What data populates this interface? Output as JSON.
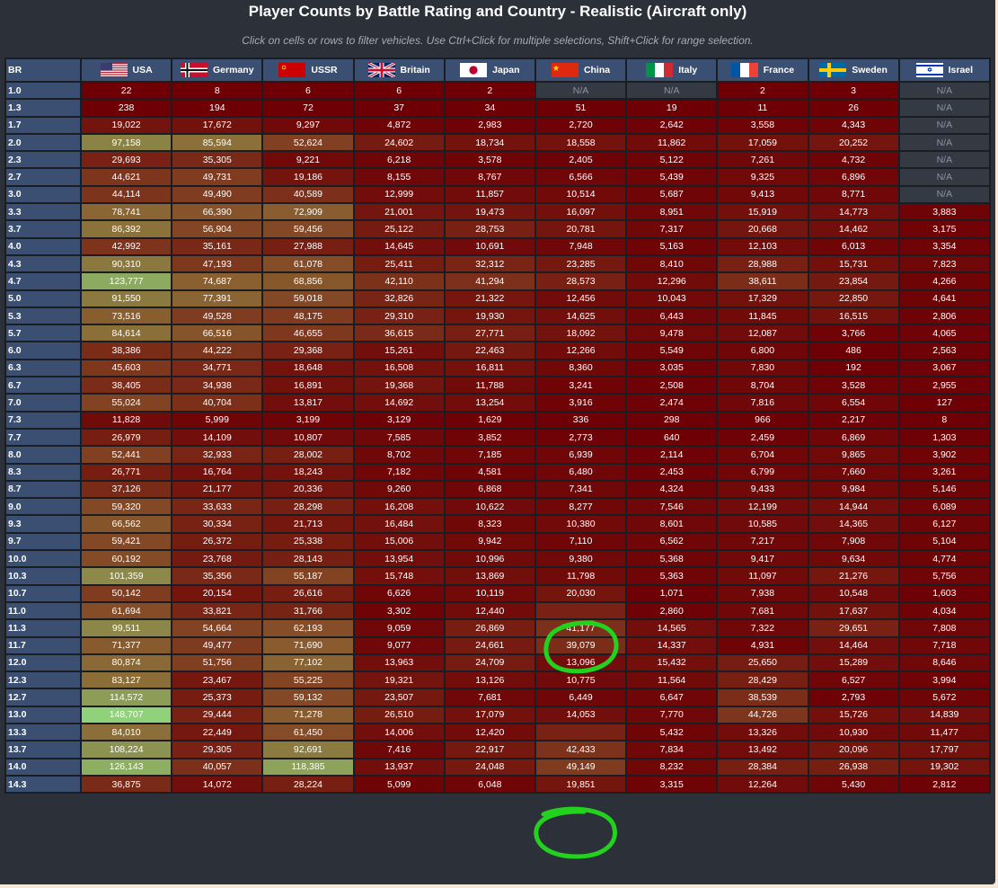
{
  "title": "Player Counts by Battle Rating and Country - Realistic (Aircraft only)",
  "subtitle": "Click on cells or rows to filter vehicles. Use Ctrl+Click for multiple selections, Shift+Click for range selection.",
  "br_header": "BR",
  "na_label": "N/A",
  "color_scale": {
    "low": "#6e0005",
    "mid": "#8a6030",
    "high": "#8fd47a"
  },
  "countries": [
    {
      "name": "USA",
      "flag": "usa-flag-icon"
    },
    {
      "name": "Germany",
      "flag": "germany-flag-icon"
    },
    {
      "name": "USSR",
      "flag": "ussr-flag-icon"
    },
    {
      "name": "Britain",
      "flag": "britain-flag-icon"
    },
    {
      "name": "Japan",
      "flag": "japan-flag-icon"
    },
    {
      "name": "China",
      "flag": "china-flag-icon"
    },
    {
      "name": "Italy",
      "flag": "italy-flag-icon"
    },
    {
      "name": "France",
      "flag": "france-flag-icon"
    },
    {
      "name": "Sweden",
      "flag": "sweden-flag-icon"
    },
    {
      "name": "Israel",
      "flag": "israel-flag-icon"
    }
  ],
  "rows": [
    {
      "br": "1.0",
      "values": [
        "22",
        "8",
        "6",
        "6",
        "2",
        "N/A",
        "N/A",
        "2",
        "3",
        "N/A"
      ]
    },
    {
      "br": "1.3",
      "values": [
        "238",
        "194",
        "72",
        "37",
        "34",
        "51",
        "19",
        "11",
        "26",
        "N/A"
      ]
    },
    {
      "br": "1.7",
      "values": [
        "19,022",
        "17,672",
        "9,297",
        "4,872",
        "2,983",
        "2,720",
        "2,642",
        "3,558",
        "4,343",
        "N/A"
      ]
    },
    {
      "br": "2.0",
      "values": [
        "97,158",
        "85,594",
        "52,624",
        "24,602",
        "18,734",
        "18,558",
        "11,862",
        "17,059",
        "20,252",
        "N/A"
      ]
    },
    {
      "br": "2.3",
      "values": [
        "29,693",
        "35,305",
        "9,221",
        "6,218",
        "3,578",
        "2,405",
        "5,122",
        "7,261",
        "4,732",
        "N/A"
      ]
    },
    {
      "br": "2.7",
      "values": [
        "44,621",
        "49,731",
        "19,186",
        "8,155",
        "8,767",
        "6,566",
        "5,439",
        "9,325",
        "6,896",
        "N/A"
      ]
    },
    {
      "br": "3.0",
      "values": [
        "44,114",
        "49,490",
        "40,589",
        "12,999",
        "11,857",
        "10,514",
        "5,687",
        "9,413",
        "8,771",
        "N/A"
      ]
    },
    {
      "br": "3.3",
      "values": [
        "78,741",
        "66,390",
        "72,909",
        "21,001",
        "19,473",
        "16,097",
        "8,951",
        "15,919",
        "14,773",
        "3,883"
      ]
    },
    {
      "br": "3.7",
      "values": [
        "86,392",
        "56,904",
        "59,456",
        "25,122",
        "28,753",
        "20,781",
        "7,317",
        "20,668",
        "14,462",
        "3,175"
      ]
    },
    {
      "br": "4.0",
      "values": [
        "42,992",
        "35,161",
        "27,988",
        "14,645",
        "10,691",
        "7,948",
        "5,163",
        "12,103",
        "6,013",
        "3,354"
      ]
    },
    {
      "br": "4.3",
      "values": [
        "90,310",
        "47,193",
        "61,078",
        "25,411",
        "32,312",
        "23,285",
        "8,410",
        "28,988",
        "15,731",
        "7,823"
      ]
    },
    {
      "br": "4.7",
      "values": [
        "123,777",
        "74,687",
        "68,856",
        "42,110",
        "41,294",
        "28,573",
        "12,296",
        "38,611",
        "23,854",
        "4,266"
      ]
    },
    {
      "br": "5.0",
      "values": [
        "91,550",
        "77,391",
        "59,018",
        "32,826",
        "21,322",
        "12,456",
        "10,043",
        "17,329",
        "22,850",
        "4,641"
      ]
    },
    {
      "br": "5.3",
      "values": [
        "73,516",
        "49,528",
        "48,175",
        "29,310",
        "19,930",
        "14,625",
        "6,443",
        "11,845",
        "16,515",
        "2,806"
      ]
    },
    {
      "br": "5.7",
      "values": [
        "84,614",
        "66,516",
        "46,655",
        "36,615",
        "27,771",
        "18,092",
        "9,478",
        "12,087",
        "3,766",
        "4,065"
      ]
    },
    {
      "br": "6.0",
      "values": [
        "38,386",
        "44,222",
        "29,368",
        "15,261",
        "22,463",
        "12,266",
        "5,549",
        "6,800",
        "486",
        "2,563"
      ]
    },
    {
      "br": "6.3",
      "values": [
        "45,603",
        "34,771",
        "18,648",
        "16,508",
        "16,811",
        "8,360",
        "3,035",
        "7,830",
        "192",
        "3,067"
      ]
    },
    {
      "br": "6.7",
      "values": [
        "38,405",
        "34,938",
        "16,891",
        "19,368",
        "11,788",
        "3,241",
        "2,508",
        "8,704",
        "3,528",
        "2,955"
      ]
    },
    {
      "br": "7.0",
      "values": [
        "55,024",
        "40,704",
        "13,817",
        "14,692",
        "13,254",
        "3,916",
        "2,474",
        "7,816",
        "6,554",
        "127"
      ]
    },
    {
      "br": "7.3",
      "values": [
        "11,828",
        "5,999",
        "3,199",
        "3,129",
        "1,629",
        "336",
        "298",
        "966",
        "2,217",
        "8"
      ]
    },
    {
      "br": "7.7",
      "values": [
        "26,979",
        "14,109",
        "10,807",
        "7,585",
        "3,852",
        "2,773",
        "640",
        "2,459",
        "6,869",
        "1,303"
      ]
    },
    {
      "br": "8.0",
      "values": [
        "52,441",
        "32,933",
        "28,002",
        "8,702",
        "7,185",
        "6,939",
        "2,114",
        "6,704",
        "9,865",
        "3,902"
      ]
    },
    {
      "br": "8.3",
      "values": [
        "26,771",
        "16,764",
        "18,243",
        "7,182",
        "4,581",
        "6,480",
        "2,453",
        "6,799",
        "7,660",
        "3,261"
      ]
    },
    {
      "br": "8.7",
      "values": [
        "37,126",
        "21,177",
        "20,336",
        "9,260",
        "6,868",
        "7,341",
        "4,324",
        "9,433",
        "9,984",
        "5,146"
      ]
    },
    {
      "br": "9.0",
      "values": [
        "59,320",
        "33,633",
        "28,298",
        "16,208",
        "10,622",
        "8,277",
        "7,546",
        "12,199",
        "14,944",
        "6,089"
      ]
    },
    {
      "br": "9.3",
      "values": [
        "66,562",
        "30,334",
        "21,713",
        "16,484",
        "8,323",
        "10,380",
        "8,601",
        "10,585",
        "14,365",
        "6,127"
      ]
    },
    {
      "br": "9.7",
      "values": [
        "59,421",
        "26,372",
        "25,338",
        "15,006",
        "9,942",
        "7,110",
        "6,562",
        "7,217",
        "7,908",
        "5,104"
      ]
    },
    {
      "br": "10.0",
      "values": [
        "60,192",
        "23,768",
        "28,143",
        "13,954",
        "10,996",
        "9,380",
        "5,368",
        "9,417",
        "9,634",
        "4,774"
      ]
    },
    {
      "br": "10.3",
      "values": [
        "101,359",
        "35,356",
        "55,187",
        "15,748",
        "13,869",
        "11,798",
        "5,363",
        "11,097",
        "21,276",
        "5,756"
      ]
    },
    {
      "br": "10.7",
      "values": [
        "50,142",
        "20,154",
        "26,616",
        "6,626",
        "10,119",
        "20,030",
        "1,071",
        "7,938",
        "10,548",
        "1,603"
      ]
    },
    {
      "br": "11.0",
      "values": [
        "61,694",
        "33,821",
        "31,766",
        "3,302",
        "12,440",
        "",
        "2,860",
        "7,681",
        "17,637",
        "4,034"
      ]
    },
    {
      "br": "11.3",
      "values": [
        "99,511",
        "54,664",
        "62,193",
        "9,059",
        "26,869",
        "41,177",
        "14,565",
        "7,322",
        "29,651",
        "7,808"
      ]
    },
    {
      "br": "11.7",
      "values": [
        "71,377",
        "49,477",
        "71,690",
        "9,077",
        "24,661",
        "39,079",
        "14,337",
        "4,931",
        "14,464",
        "7,718"
      ]
    },
    {
      "br": "12.0",
      "values": [
        "80,874",
        "51,756",
        "77,102",
        "13,963",
        "24,709",
        "13,096",
        "15,432",
        "25,650",
        "15,289",
        "8,646"
      ]
    },
    {
      "br": "12.3",
      "values": [
        "83,127",
        "23,467",
        "55,225",
        "19,321",
        "13,126",
        "10,775",
        "11,564",
        "28,429",
        "6,527",
        "3,994"
      ]
    },
    {
      "br": "12.7",
      "values": [
        "114,572",
        "25,373",
        "59,132",
        "23,507",
        "7,681",
        "6,449",
        "6,647",
        "38,539",
        "2,793",
        "5,672"
      ]
    },
    {
      "br": "13.0",
      "values": [
        "148,707",
        "29,444",
        "71,278",
        "26,510",
        "17,079",
        "14,053",
        "7,770",
        "44,726",
        "15,726",
        "14,839"
      ]
    },
    {
      "br": "13.3",
      "values": [
        "84,010",
        "22,449",
        "61,450",
        "14,006",
        "12,420",
        "",
        "5,432",
        "13,326",
        "10,930",
        "11,477"
      ]
    },
    {
      "br": "13.7",
      "values": [
        "108,224",
        "29,305",
        "92,691",
        "7,416",
        "22,917",
        "42,433",
        "7,834",
        "13,492",
        "20,096",
        "17,797"
      ]
    },
    {
      "br": "14.0",
      "values": [
        "126,143",
        "40,057",
        "118,385",
        "13,937",
        "24,048",
        "49,149",
        "8,232",
        "28,384",
        "26,938",
        "19,302"
      ]
    },
    {
      "br": "14.3",
      "values": [
        "36,875",
        "14,072",
        "28,224",
        "5,099",
        "6,048",
        "19,851",
        "3,315",
        "12,264",
        "5,430",
        "2,812"
      ]
    }
  ]
}
